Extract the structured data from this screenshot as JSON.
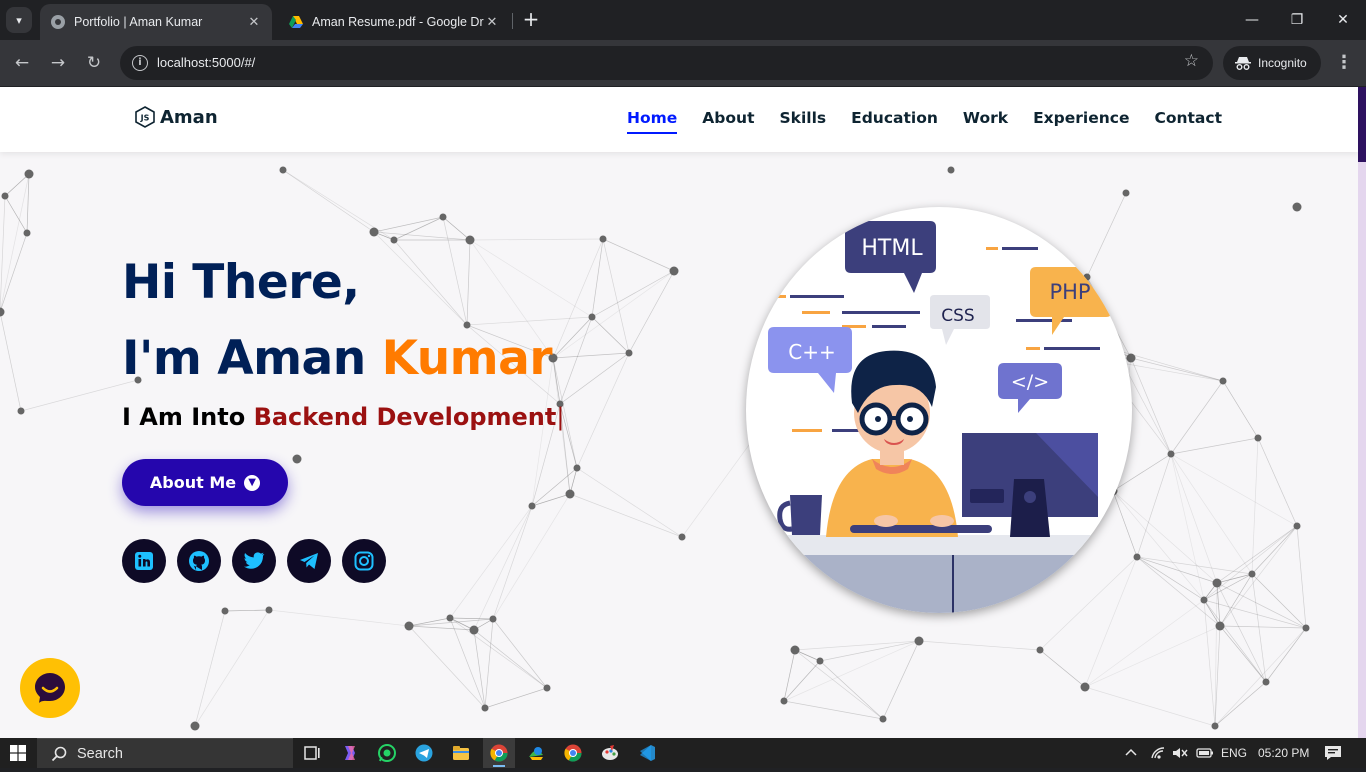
{
  "browser": {
    "tabs": [
      {
        "title": "Portfolio | Aman Kumar",
        "active": true
      },
      {
        "title": "Aman Resume.pdf - Google Dri",
        "active": false
      }
    ],
    "url": "localhost:5000/#/",
    "profile_label": "Incognito"
  },
  "site": {
    "brand": "Aman",
    "nav": [
      "Home",
      "About",
      "Skills",
      "Education",
      "Work",
      "Experience",
      "Contact"
    ],
    "active_nav": "Home"
  },
  "hero": {
    "greeting": "Hi There,",
    "intro_prefix": "I'm Aman ",
    "intro_accent": "Kumar",
    "typed_prefix": "I Am Into ",
    "typed_role": "Backend Development",
    "typed_cursor": "|",
    "cta_label": "About Me",
    "socials": [
      "linkedin-icon",
      "github-icon",
      "twitter-icon",
      "telegram-icon",
      "instagram-icon"
    ],
    "illustration_labels": [
      "HTML",
      "CSS",
      "PHP",
      "C++",
      "</>"
    ]
  },
  "colors": {
    "navy": "#002057",
    "accent_orange": "#ff7b00",
    "role_red": "#9b1111",
    "button_blue": "#2506ad",
    "nav_active": "#011aff",
    "chat_yellow": "#ffc004"
  },
  "taskbar": {
    "search_placeholder": "Search",
    "language": "ENG",
    "time": "05:20 PM"
  }
}
